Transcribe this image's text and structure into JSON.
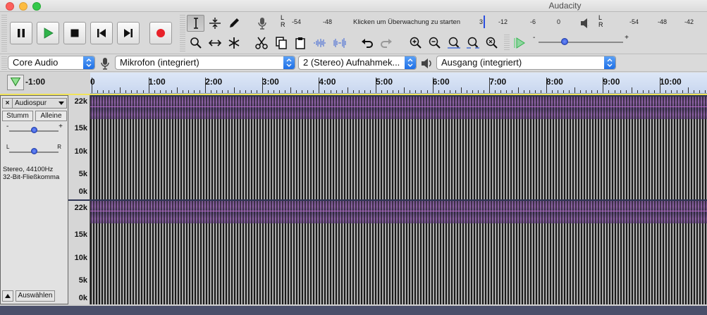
{
  "window": {
    "title": "Audacity"
  },
  "transport": {
    "pause": "pause-icon",
    "play": "play-icon",
    "stop": "stop-icon",
    "skip_start": "skip-start-icon",
    "skip_end": "skip-end-icon",
    "record": "record-icon"
  },
  "record_meter": {
    "lr": [
      "L",
      "R"
    ],
    "ticks": [
      "-54",
      "-48",
      "-12",
      "-6",
      "0"
    ],
    "hint": "Klicken um Überwachung zu starten",
    "partial": "3"
  },
  "play_meter": {
    "lr": [
      "L",
      "R"
    ],
    "ticks": [
      "-54",
      "-48",
      "-42"
    ]
  },
  "playback_speed": {
    "minus": "-",
    "plus": "+"
  },
  "devices": {
    "host": "Core Audio",
    "input": "Mikrofon (integriert)",
    "channels": "2 (Stereo) Aufnahmek...",
    "output": "Ausgang (integriert)"
  },
  "timeline": {
    "negative_label": "-1:00",
    "labels": [
      "0",
      "1:00",
      "2:00",
      "3:00",
      "4:00",
      "5:00",
      "6:00",
      "7:00",
      "8:00",
      "9:00",
      "10:00"
    ]
  },
  "track": {
    "name": "Audiospur",
    "mute": "Stumm",
    "solo": "Alleine",
    "gain_minus": "-",
    "gain_plus": "+",
    "pan_left": "L",
    "pan_right": "R",
    "info_line1": "Stereo, 44100Hz",
    "info_line2": "32-Bit-Fließkomma",
    "select": "Auswählen",
    "close": "×"
  },
  "vscale": [
    "22k",
    "15k",
    "10k",
    "5k",
    "0k"
  ],
  "colors": {
    "accent": "#2a6fe6",
    "record": "#e8222a",
    "play": "#2fb34a",
    "band": "#8a5ba4"
  }
}
